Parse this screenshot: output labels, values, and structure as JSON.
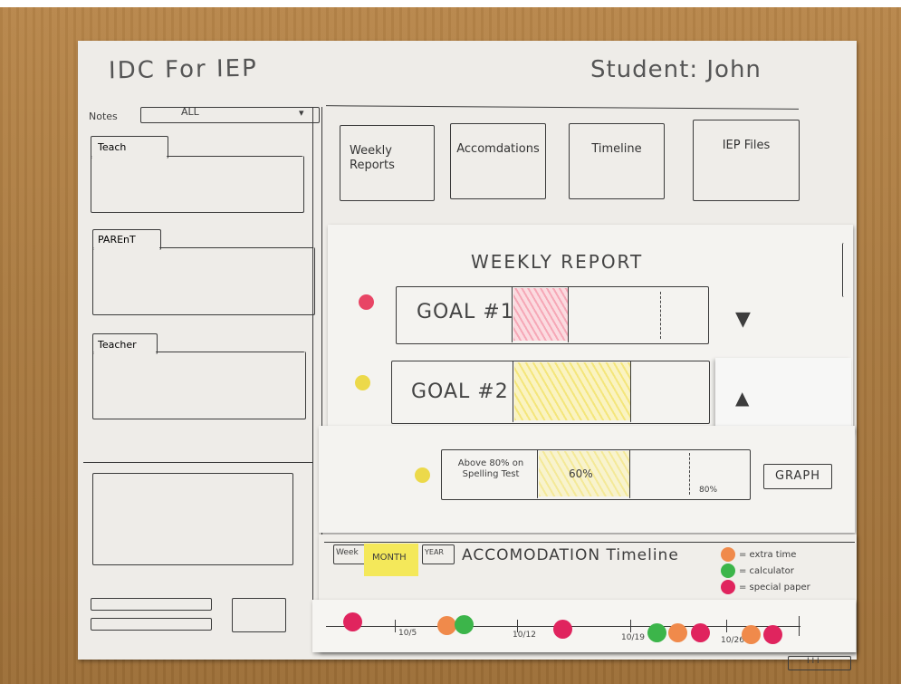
{
  "header": {
    "app_title": "IDC For IEP",
    "student_label": "Student: John"
  },
  "notes": {
    "label": "Notes",
    "filter_value": "ALL",
    "panels": [
      {
        "tab": "Teach"
      },
      {
        "tab": "PAREnT"
      },
      {
        "tab": "Teacher"
      }
    ]
  },
  "nav": {
    "buttons": [
      {
        "label": "Weekly Reports"
      },
      {
        "label": "Accomdations"
      },
      {
        "label": "Timeline"
      },
      {
        "label": "IEP Files"
      }
    ]
  },
  "weekly_report": {
    "title": "WEEKLY REPORT",
    "goals": [
      {
        "label": "GOAL #1",
        "status_color": "#e84565",
        "hatch": "pink"
      },
      {
        "label": "GOAL #2",
        "status_color": "#ecd94a",
        "hatch": "yellow"
      }
    ],
    "detail": {
      "criterion": "Above 80% on Spelling Test",
      "current": "60%",
      "target": "80%",
      "status_color": "#ecd94a",
      "graph_label": "GRAPH"
    }
  },
  "timeline": {
    "title": "ACCOMODATION Timeline",
    "tabs": [
      {
        "label": "Week",
        "active": false
      },
      {
        "label": "MONTH",
        "active": true
      },
      {
        "label": "YEAR",
        "active": false
      }
    ],
    "legend": [
      {
        "color": "#f08a4b",
        "label": "= extra time"
      },
      {
        "color": "#3cb54a",
        "label": "= calculator"
      },
      {
        "color": "#e0245e",
        "label": "= special paper"
      }
    ],
    "ticks": [
      "10/5",
      "10/12",
      "10/19",
      "10/26"
    ],
    "footer_glyph": "I I I"
  },
  "colors": {
    "pink": "#e84565",
    "yellow": "#ecd94a",
    "orange": "#f08a4b",
    "green": "#3cb54a",
    "magenta": "#e0245e"
  }
}
